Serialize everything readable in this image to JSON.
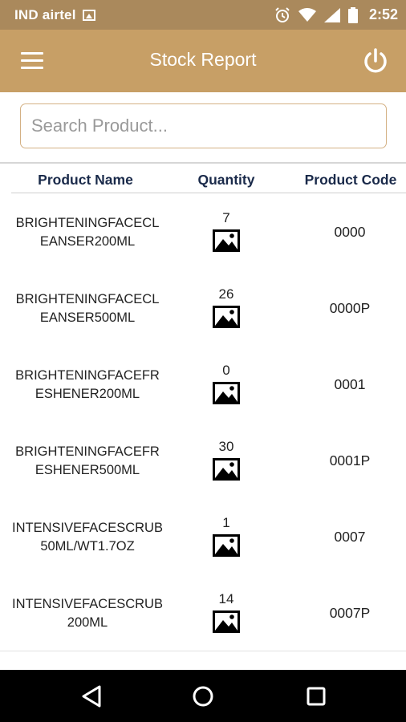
{
  "status_bar": {
    "carrier": "IND airtel",
    "time": "2:52",
    "icons": [
      "gallery-icon",
      "alarm-icon",
      "wifi-icon",
      "signal-icon",
      "battery-icon"
    ]
  },
  "app_bar": {
    "title": "Stock Report",
    "menu_icon": "menu-icon",
    "power_icon": "power-icon"
  },
  "search": {
    "placeholder": "Search Product...",
    "value": ""
  },
  "table": {
    "headers": {
      "name": "Product Name",
      "quantity": "Quantity",
      "code": "Product Code"
    },
    "rows": [
      {
        "name_line1": "BRIGHTENINGFACECL",
        "name_line2": "EANSER200ML",
        "quantity": "7",
        "code": "0000"
      },
      {
        "name_line1": "BRIGHTENINGFACECL",
        "name_line2": "EANSER500ML",
        "quantity": "26",
        "code": "0000P"
      },
      {
        "name_line1": "BRIGHTENINGFACEFR",
        "name_line2": "ESHENER200ML",
        "quantity": "0",
        "code": "0001"
      },
      {
        "name_line1": "BRIGHTENINGFACEFR",
        "name_line2": "ESHENER500ML",
        "quantity": "30",
        "code": "0001P"
      },
      {
        "name_line1": "INTENSIVEFACESCRUB",
        "name_line2": "50ML/WT1.7OZ",
        "quantity": "1",
        "code": "0007"
      },
      {
        "name_line1": "INTENSIVEFACESCRUB",
        "name_line2": "200ML",
        "quantity": "14",
        "code": "0007P"
      }
    ]
  },
  "colors": {
    "status_bar": "#aa895c",
    "app_bar": "#c79f66",
    "search_border": "#d4b184",
    "header_text": "#1a2a4a"
  },
  "nav_bar": {
    "icons": [
      "back-icon",
      "home-icon",
      "recents-icon"
    ]
  }
}
